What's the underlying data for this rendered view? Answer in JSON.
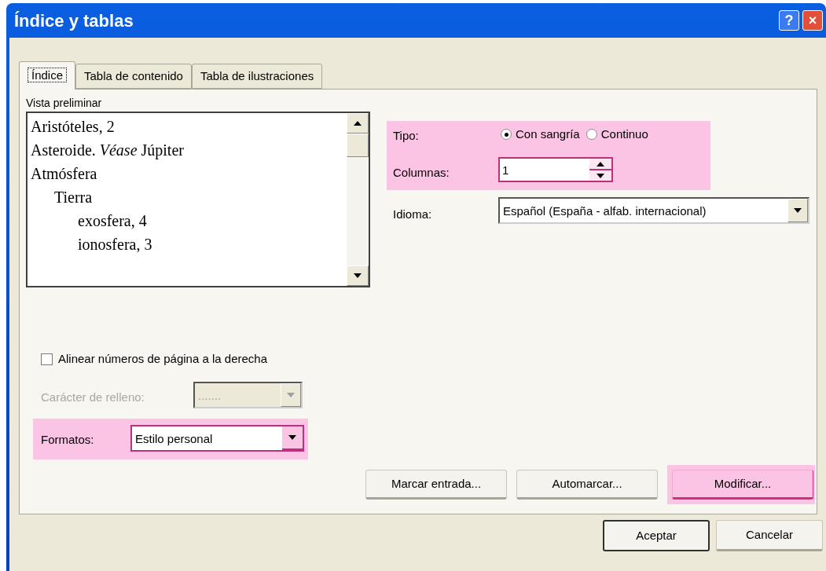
{
  "window": {
    "title": "Índice y tablas",
    "controls": [
      {
        "kind": "help",
        "label": "?"
      },
      {
        "kind": "close",
        "label": "×"
      }
    ]
  },
  "tabs": [
    {
      "label": "Índice",
      "selected": true
    },
    {
      "label": "Tabla de contenido",
      "selected": false
    },
    {
      "label": "Tabla de ilustraciones",
      "selected": false
    }
  ],
  "preview": {
    "label": "Vista preliminar",
    "entries": [
      {
        "text": "Aristóteles, 2"
      },
      {
        "text": "Asteroide. *Véase* Júpiter"
      },
      {
        "text": "Atmósfera",
        "children": [
          {
            "text": "Tierra",
            "children": [
              {
                "text": "exosfera, 4"
              },
              {
                "text": "ionosfera, 3"
              }
            ]
          }
        ]
      }
    ]
  },
  "type_group": {
    "highlighted": true,
    "label": "Tipo:",
    "options": [
      {
        "label": "Con sangría",
        "selected": true
      },
      {
        "label": "Continuo",
        "selected": false
      }
    ],
    "columns": {
      "label": "Columnas:",
      "value": "1"
    }
  },
  "language": {
    "label": "Idioma:",
    "value": "Español (España - alfab. internacional)"
  },
  "align_numbers": {
    "label": "Alinear números de página a la derecha",
    "checked": false
  },
  "fill_char": {
    "label": "Carácter de relleno:",
    "value": ".......",
    "disabled": true
  },
  "formats": {
    "label": "Formatos:",
    "value": "Estilo personal",
    "highlighted": true
  },
  "action_buttons": [
    {
      "label": "Marcar entrada...",
      "highlighted": false
    },
    {
      "label": "Automarcar...",
      "highlighted": false
    },
    {
      "label": "Modificar...",
      "highlighted": true
    }
  ],
  "dialog_buttons": [
    {
      "label": "Aceptar",
      "default": true
    },
    {
      "label": "Cancelar",
      "default": false
    }
  ]
}
